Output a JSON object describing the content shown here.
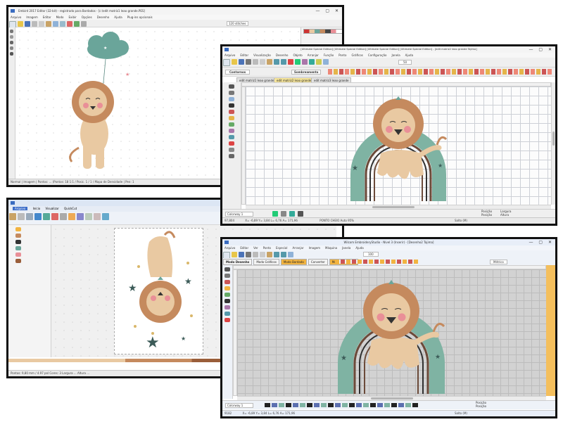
{
  "windows": {
    "w1": {
      "title": "Embird 2017 Editor (32-bit) - registrado para Bordados - [c:\\edit matriz1 leao grande.PES]",
      "menu": [
        "Arquivo",
        "Imagem",
        "Editar",
        "Modo",
        "Exibir",
        "Opções",
        "Desenho",
        "Ajuda",
        "Plug-ins opcionais"
      ],
      "stitches_field": "120 stitches",
      "status": "Normal | Imagem | Pontos: ... (Pontos: 18 1:1 / Posic. 1 / 1 / Mapa de Densidade | Pen: 1"
    },
    "w2": {
      "title": "[Ultimate Special Edition] [Ultimate Special Edition] [Ultimate Special Edition] [Ultimate Special Edition] - [edit matriz2 leao grande      Tajima]",
      "menu": [
        "Arquivo",
        "Editar",
        "Visualização",
        "Desenho",
        "Objeto",
        "Arranjar",
        "Função",
        "Ponto",
        "Gráficos",
        "Configuração",
        "Janela",
        "Ajuda"
      ],
      "mode_label": "Contornos",
      "mode_label2": "Sombreamento",
      "zoom": "50",
      "tabs": [
        "edit matriz1 leao grande",
        "edit matriz2 leao grande",
        "edit matriz3 leao grande"
      ],
      "colorway": "Colorway 1",
      "status_left": "97,804",
      "status_coords": "X= -6,89 Y= 3,84 L= 6,76 A= 171,96",
      "status_mode": "PONTO CHEIO Auto 95%",
      "status_right": "Salto (M)",
      "pos_label_1": "Posição",
      "pos_label_2": "Posição",
      "width_label": "Largura",
      "height_label": "Altura"
    },
    "w3": {
      "tabs": [
        "Arquivo",
        "Início",
        "Visualizar",
        "QuickCut"
      ],
      "status": "Pontos: 9,80 mm / 4.97 pol   Cores: 3   Largura ... Altura ..."
    },
    "w4": {
      "title": "Wilcom EmbroideryStudio - Nível 3 (Inserir) - [Desenho2      Tajima]",
      "menu": [
        "Arquivo",
        "Editar",
        "Ver",
        "Ponto",
        "Especial",
        "Arranjar",
        "Imagem",
        "Máquina",
        "Janela",
        "Ajuda"
      ],
      "modes": [
        "Modo Desenho",
        "Modo Gráficos",
        "Modo Bordado",
        "Converter",
        "Mostrar Gráficos"
      ],
      "zoom": "100",
      "metric": "Métrico",
      "colorway": "Colorway 1",
      "status_left": "9182",
      "status_coords": "X= -6,89 Y= 3,84 L= 6,76 A= 171,96",
      "status_right": "Salto (M)",
      "pos_label_1": "Posição",
      "pos_label_2": "Posição"
    }
  },
  "colors": {
    "skin": "#e9c9a2",
    "mane": "#c58a5e",
    "mane_dark": "#9a5e3a",
    "balloon": "#6aa59a",
    "rainbow_green": "#7fb3a3",
    "rainbow_brown": "#6b4a39",
    "rainbow_dark": "#2f2f2f",
    "star": "#3c5b58",
    "cheek": "#e98f97",
    "accent_orange": "#f2b441"
  },
  "icons": {
    "window_controls": "— ▢ ✕",
    "star": "★"
  }
}
